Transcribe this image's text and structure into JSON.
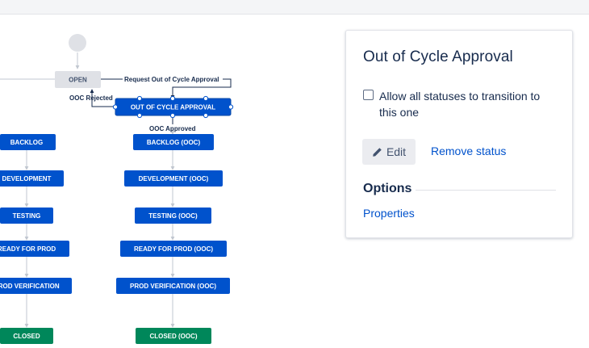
{
  "workflow": {
    "nodes": {
      "open": "OPEN",
      "ooc_approval": "OUT OF CYCLE APPROVAL",
      "backlog": "BACKLOG",
      "development": "DEVELOPMENT",
      "testing": "TESTING",
      "ready_for_prod": "READY FOR PROD",
      "prod_verification": "PROD VERIFICATION",
      "closed": "CLOSED",
      "backlog_ooc": "BACKLOG (OOC)",
      "development_ooc": "DEVELOPMENT (OOC)",
      "testing_ooc": "TESTING (OOC)",
      "ready_for_prod_ooc": "READY FOR PROD (OOC)",
      "prod_verification_ooc": "PROD VERIFICATION (OOC)",
      "closed_ooc": "CLOSED (OOC)"
    },
    "transitions": {
      "request_ooc": "Request Out of Cycle Approval",
      "ooc_rejected": "OOC Rejected",
      "ooc_approved": "OOC Approved"
    },
    "colors": {
      "status_blue": "#0052cc",
      "status_green": "#00875a",
      "status_grey": "#dfe1e6",
      "start_circle": "#dfe1e6"
    }
  },
  "panel": {
    "title": "Out of Cycle Approval",
    "allow_all_label": "Allow all statuses to transition to this one",
    "allow_all_checked": false,
    "edit_label": "Edit",
    "remove_label": "Remove status",
    "options_heading": "Options",
    "properties_label": "Properties",
    "icons": {
      "edit": "pencil-icon"
    }
  }
}
